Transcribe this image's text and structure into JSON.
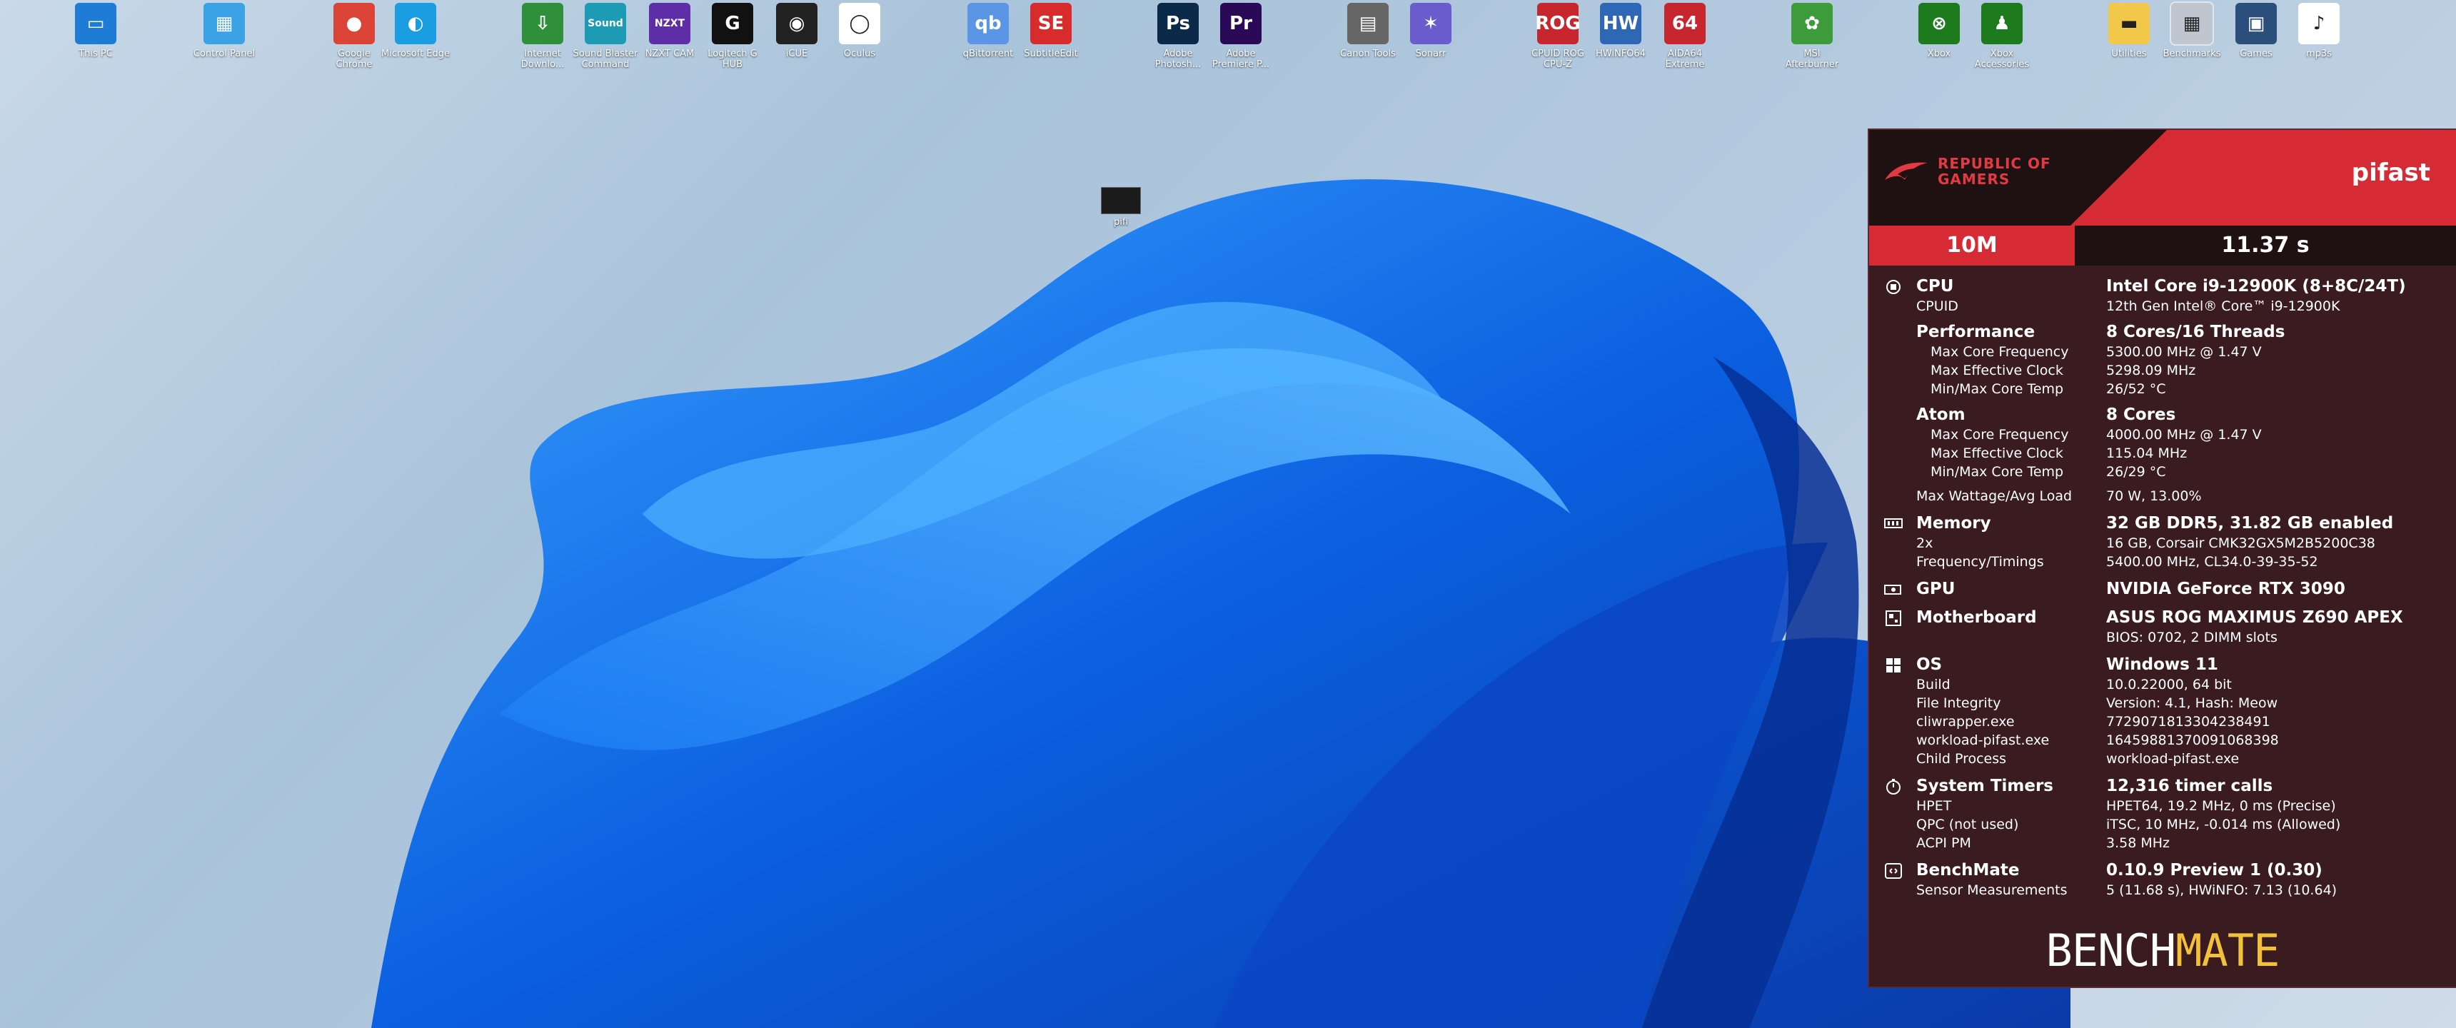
{
  "desktop": {
    "icons": [
      {
        "label": "This PC",
        "glyph": "▭",
        "color": "#1e7bd6"
      },
      {
        "label": "Control Panel",
        "glyph": "▦",
        "color": "#3ba2e6"
      },
      {
        "label": "Google Chrome",
        "glyph": "●",
        "color": "#db4437"
      },
      {
        "label": "Microsoft Edge",
        "glyph": "◐",
        "color": "#1b9de2"
      },
      {
        "label": "Internet Downlo...",
        "glyph": "⇩",
        "color": "#2f8f3a"
      },
      {
        "label": "Sound Blaster Command",
        "glyph": "Sound",
        "color": "#1d9bb5"
      },
      {
        "label": "NZXT CAM",
        "glyph": "NZXT",
        "color": "#5d2ea8"
      },
      {
        "label": "Logitech G HUB",
        "glyph": "G",
        "color": "#111111"
      },
      {
        "label": "iCUE",
        "glyph": "◉",
        "color": "#222222"
      },
      {
        "label": "Oculus",
        "glyph": "◯",
        "color": "#ffffff"
      },
      {
        "label": "qBittorrent",
        "glyph": "qb",
        "color": "#5b95e6"
      },
      {
        "label": "SubtitleEdit",
        "glyph": "SE",
        "color": "#d82c2c"
      },
      {
        "label": "Adobe Photosh...",
        "glyph": "Ps",
        "color": "#0b2a4a"
      },
      {
        "label": "Adobe Premiere P...",
        "glyph": "Pr",
        "color": "#2a0a56"
      },
      {
        "label": "Canon Tools",
        "glyph": "▤",
        "color": "#666666"
      },
      {
        "label": "Sonarr",
        "glyph": "✶",
        "color": "#6a5ccc"
      },
      {
        "label": "CPUID ROG CPU-Z",
        "glyph": "ROG",
        "color": "#c8262e"
      },
      {
        "label": "HWiNFO64",
        "glyph": "HW",
        "color": "#2d67b5"
      },
      {
        "label": "AIDA64 Extreme",
        "glyph": "64",
        "color": "#c8262e"
      },
      {
        "label": "MSI Afterburner",
        "glyph": "✿",
        "color": "#3e9b3c"
      },
      {
        "label": "Xbox",
        "glyph": "⊗",
        "color": "#1d7a1d"
      },
      {
        "label": "Xbox Accessories",
        "glyph": "♟",
        "color": "#1d7a1d"
      },
      {
        "label": "Utilities",
        "glyph": "▬",
        "color": "#f1c84a"
      },
      {
        "label": "Benchmarks",
        "glyph": "▦",
        "color": "#bfc6d0"
      },
      {
        "label": "Games",
        "glyph": "▣",
        "color": "#2b4f7a"
      },
      {
        "label": "mp3s",
        "glyph": "♪",
        "color": "#ffffff"
      }
    ],
    "loose_file": {
      "label": "pifi"
    }
  },
  "panel": {
    "brand": {
      "line1": "REPUBLIC OF",
      "line2": "GAMERS"
    },
    "benchmark": "pifast",
    "result_size": "10M",
    "result_time": "11.37 s",
    "cpu": {
      "label": "CPU",
      "value": "Intel Core i9-12900K (8+8C/24T)",
      "cpuid_label": "CPUID",
      "cpuid_value": "12th Gen Intel® Core™ i9-12900K",
      "perf_label": "Performance",
      "perf_value": "8 Cores/16 Threads",
      "perf_rows": [
        {
          "k": "Max Core Frequency",
          "v": "5300.00 MHz @ 1.47 V"
        },
        {
          "k": "Max Effective Clock",
          "v": "5298.09 MHz"
        },
        {
          "k": "Min/Max Core Temp",
          "v": "26/52 °C"
        }
      ],
      "atom_label": "Atom",
      "atom_value": "8 Cores",
      "atom_rows": [
        {
          "k": "Max Core Frequency",
          "v": "4000.00 MHz @ 1.47 V"
        },
        {
          "k": "Max Effective Clock",
          "v": "115.04 MHz"
        },
        {
          "k": "Min/Max Core Temp",
          "v": "26/29 °C"
        }
      ],
      "wattage_label": "Max Wattage/Avg Load",
      "wattage_value": "70 W, 13.00%"
    },
    "memory": {
      "label": "Memory",
      "value": "32 GB DDR5, 31.82 GB enabled",
      "rows": [
        {
          "k": "2x",
          "v": "16 GB, Corsair CMK32GX5M2B5200C38"
        },
        {
          "k": "Frequency/Timings",
          "v": "5400.00 MHz, CL34.0-39-35-52"
        }
      ]
    },
    "gpu": {
      "label": "GPU",
      "value": "NVIDIA GeForce RTX 3090"
    },
    "motherboard": {
      "label": "Motherboard",
      "value": "ASUS ROG MAXIMUS Z690 APEX",
      "bios": "BIOS: 0702, 2 DIMM slots"
    },
    "os": {
      "label": "OS",
      "value": "Windows 11",
      "rows": [
        {
          "k": "Build",
          "v": "10.0.22000, 64 bit"
        },
        {
          "k": "File Integrity",
          "v": "Version: 4.1, Hash: Meow"
        },
        {
          "k": "cliwrapper.exe",
          "v": "7729071813304238491"
        },
        {
          "k": "workload-pifast.exe",
          "v": "16459881370091068398"
        },
        {
          "k": "Child Process",
          "v": "workload-pifast.exe"
        }
      ]
    },
    "timers": {
      "label": "System Timers",
      "value": "12,316 timer calls",
      "rows": [
        {
          "k": "HPET",
          "v": "HPET64, 19.2 MHz, 0 ms (Precise)"
        },
        {
          "k": "QPC (not used)",
          "v": "iTSC, 10 MHz, -0.014 ms (Allowed)"
        },
        {
          "k": "ACPI PM",
          "v": "3.58 MHz"
        }
      ]
    },
    "benchmate": {
      "label": "BenchMate",
      "value": "0.10.9 Preview 1 (0.30)",
      "rows": [
        {
          "k": "Sensor Measurements",
          "v": "5 (11.68 s), HWiNFO: 7.13 (10.64)"
        }
      ]
    },
    "footer": {
      "part1": "BENCH",
      "part2": "MATE"
    },
    "colors": {
      "accent": "#d62b34",
      "background": "#3a1b1f",
      "logo_gold": "#f2c13a"
    }
  }
}
